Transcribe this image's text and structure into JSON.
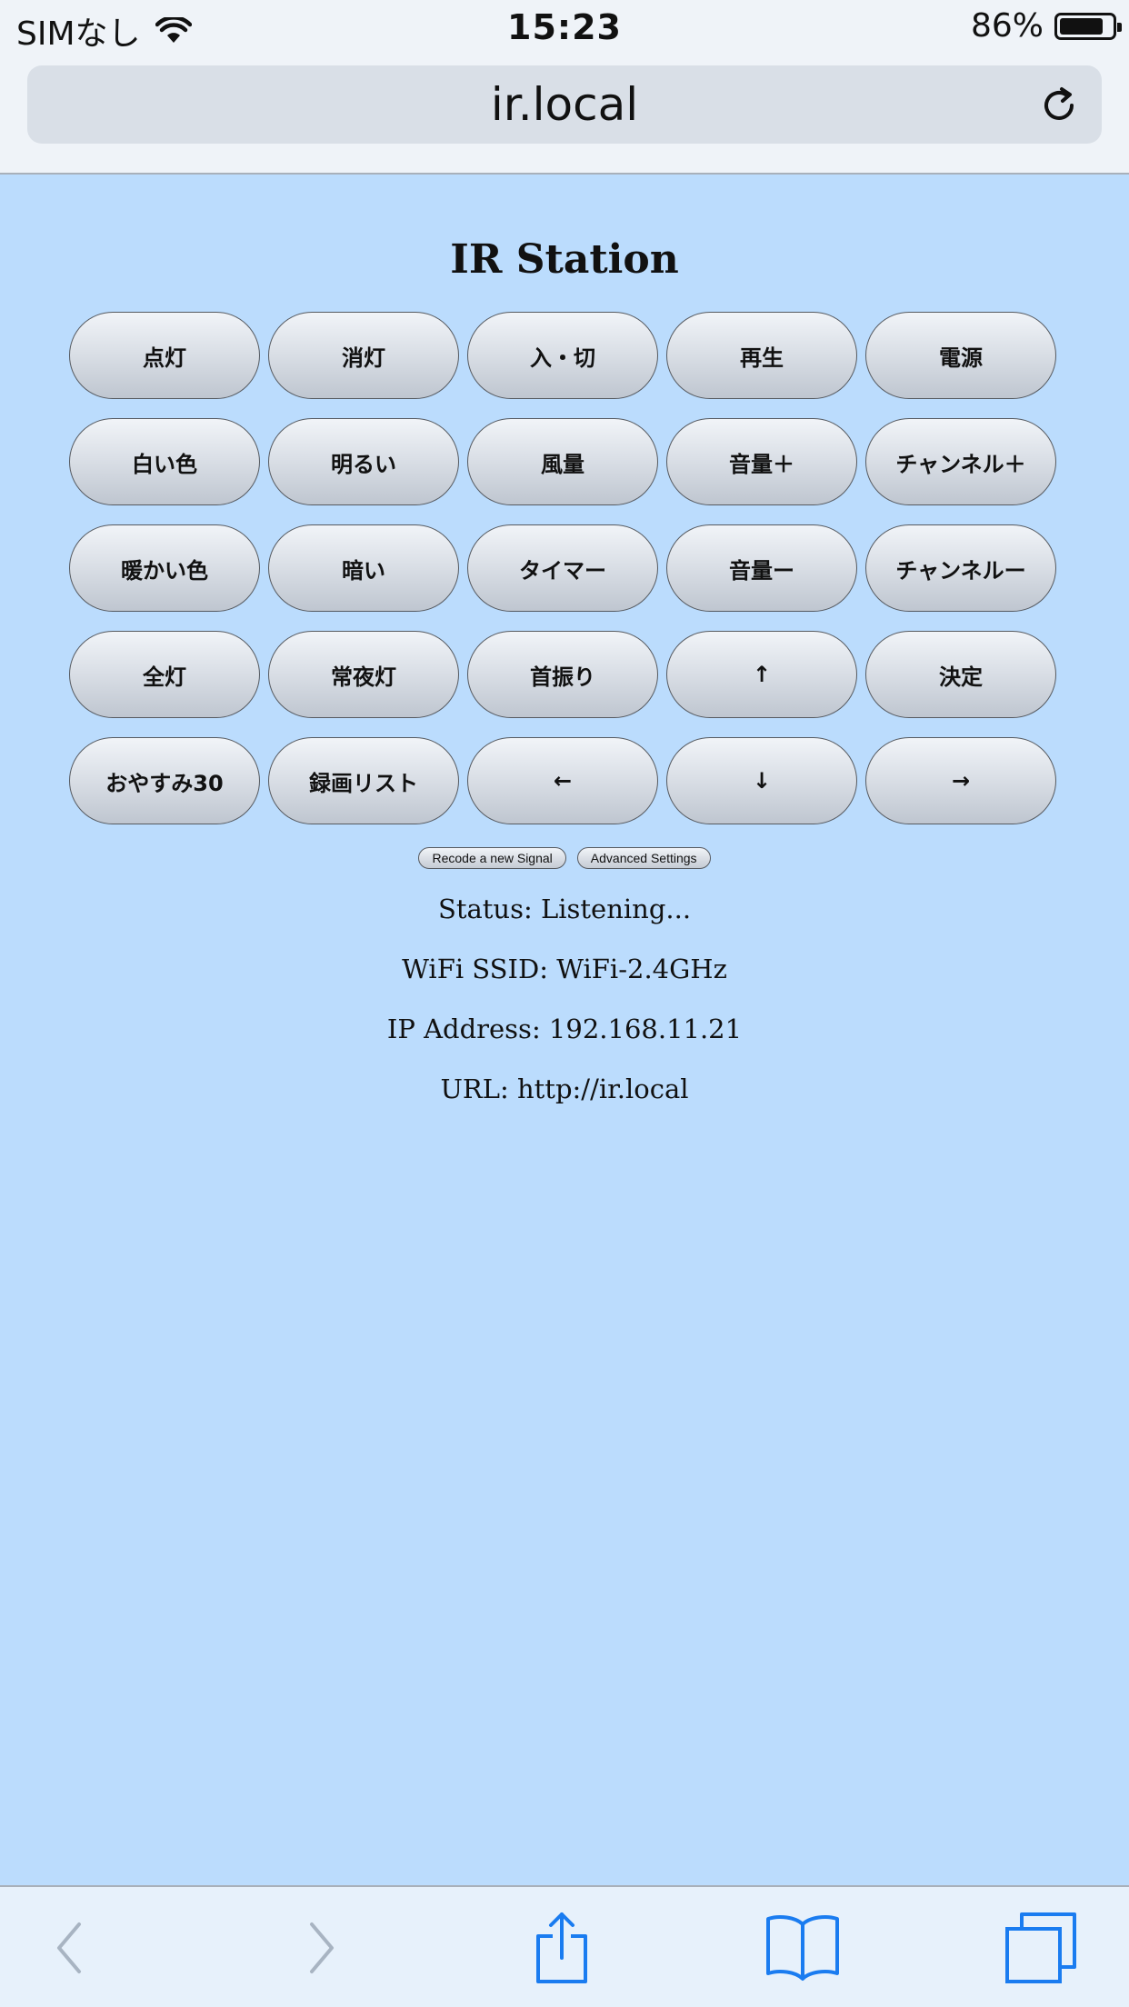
{
  "status_bar": {
    "carrier": "SIMなし",
    "time": "15:23",
    "battery_percent": "86%",
    "battery_level": 0.86
  },
  "browser": {
    "url": "ir.local",
    "toolbar": {
      "back_icon": "chevron-left-icon",
      "forward_icon": "chevron-right-icon",
      "share_icon": "share-icon",
      "bookmarks_icon": "book-icon",
      "tabs_icon": "tabs-icon"
    }
  },
  "page": {
    "title": "IR Station",
    "buttons": [
      "点灯",
      "消灯",
      "入・切",
      "再生",
      "電源",
      "白い色",
      "明るい",
      "風量",
      "音量＋",
      "チャンネル＋",
      "暖かい色",
      "暗い",
      "タイマー",
      "音量ー",
      "チャンネルー",
      "全灯",
      "常夜灯",
      "首振り",
      "↑",
      "決定",
      "おやすみ30",
      "録画リスト",
      "←",
      "↓",
      "→"
    ],
    "recode_button": "Recode a new Signal",
    "advanced_button": "Advanced Settings",
    "status": "Status: Listening...",
    "wifi_ssid": "WiFi SSID: WiFi-2.4GHz",
    "ip_address": "IP Address: 192.168.11.21",
    "url_line": "URL: http://ir.local"
  },
  "colors": {
    "page_background": "#bbdcfd",
    "toolbar_blue": "#1a7cf0",
    "toolbar_disabled": "#a8b4c2"
  }
}
